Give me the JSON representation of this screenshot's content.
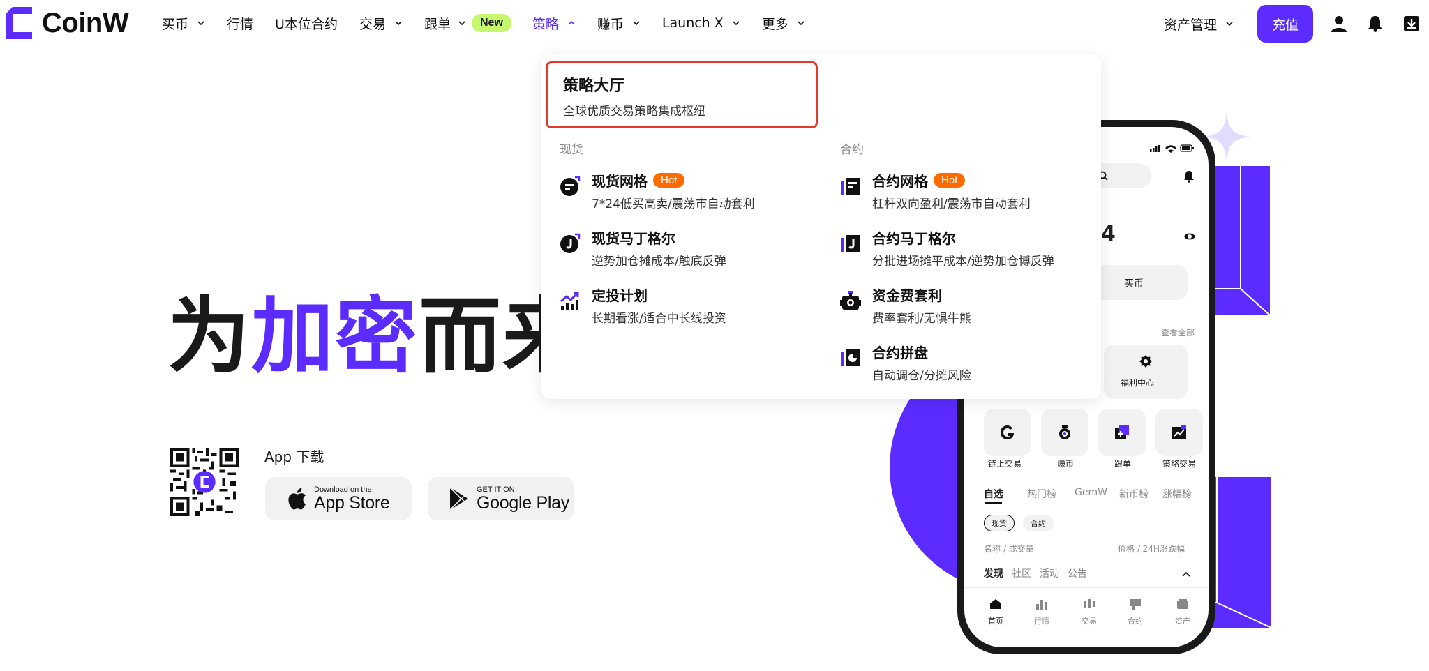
{
  "brand": {
    "name": "CoinW",
    "accent": "#5b2bff"
  },
  "nav": {
    "items": [
      {
        "label": "买币",
        "has_menu": true
      },
      {
        "label": "行情",
        "has_menu": false
      },
      {
        "label": "U本位合约",
        "has_menu": false
      },
      {
        "label": "交易",
        "has_menu": true
      },
      {
        "label": "跟单",
        "has_menu": true,
        "badge": "New"
      },
      {
        "label": "策略",
        "has_menu": true,
        "active": true
      },
      {
        "label": "赚币",
        "has_menu": true
      },
      {
        "label": "Launch X",
        "has_menu": true
      },
      {
        "label": "更多",
        "has_menu": true
      }
    ],
    "asset_menu": "资产管理",
    "deposit": "充值",
    "icons": [
      "user-icon",
      "bell-icon",
      "download-icon"
    ]
  },
  "hero": {
    "title_pre": "为",
    "title_accent": "加密",
    "title_post": "而来",
    "app_download": "App 下载",
    "app_store": {
      "small": "Download on the",
      "big": "App Store"
    },
    "google_play": {
      "small": "GET IT ON",
      "big": "Google Play"
    }
  },
  "dropdown": {
    "hall": {
      "title": "策略大厅",
      "desc": "全球优质交易策略集成枢纽"
    },
    "spot": {
      "heading": "现货",
      "items": [
        {
          "title": "现货网格",
          "badge": "Hot",
          "desc": "7*24低买高卖/震荡市自动套利",
          "icon": "grid-bot-icon"
        },
        {
          "title": "现货马丁格尔",
          "desc": "逆势加仓摊成本/触底反弹",
          "icon": "martingale-icon"
        },
        {
          "title": "定投计划",
          "desc": "长期看涨/适合中长线投资",
          "icon": "dca-chart-icon"
        }
      ]
    },
    "futures": {
      "heading": "合约",
      "items": [
        {
          "title": "合约网格",
          "badge": "Hot",
          "desc": "杠杆双向盈利/震荡市自动套利",
          "icon": "futures-grid-icon"
        },
        {
          "title": "合约马丁格尔",
          "desc": "分批进场摊平成本/逆势加仓博反弹",
          "icon": "futures-martingale-icon"
        },
        {
          "title": "资金费套利",
          "desc": "费率套利/无惧牛熊",
          "icon": "funding-rate-icon"
        },
        {
          "title": "合约拼盘",
          "desc": "自动调仓/分摊风险",
          "icon": "futures-combo-icon"
        }
      ]
    }
  },
  "phone": {
    "buy_coin": "买币",
    "view_all": "查看全部",
    "welfare": "福利中心",
    "tiles": [
      "链上交易",
      "赚币",
      "跟单",
      "策略交易"
    ],
    "market_tabs": [
      "自选",
      "热门榜",
      "GemW",
      "新币榜",
      "涨幅榜"
    ],
    "filter_pills": [
      "现货",
      "合约"
    ],
    "list_header_left": "名称 / 成交量",
    "list_header_right": "价格 / 24H涨跌幅",
    "sub_tabs": [
      "发现",
      "社区",
      "活动",
      "公告"
    ],
    "bottom_nav": [
      "首页",
      "行情",
      "交易",
      "合约",
      "资产"
    ]
  }
}
